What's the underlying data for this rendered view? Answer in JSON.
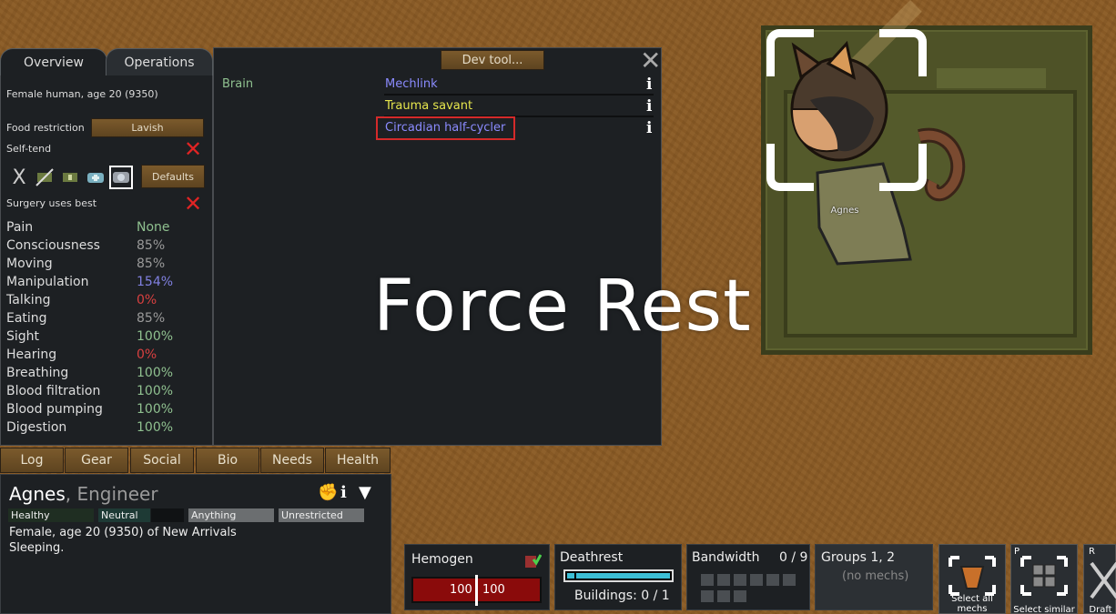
{
  "health_panel": {
    "tabs": [
      "Overview",
      "Operations"
    ],
    "summary": "Female human, age 20 (9350)",
    "food_restriction_label": "Food restriction",
    "food_restriction_value": "Lavish",
    "self_tend_label": "Self-tend",
    "defaults_label": "Defaults",
    "surgery_label": "Surgery uses best",
    "capacities": [
      {
        "name": "Pain",
        "value": "None",
        "color": "#8fc08f"
      },
      {
        "name": "Consciousness",
        "value": "85%",
        "color": "#9a9a9a"
      },
      {
        "name": "Moving",
        "value": "85%",
        "color": "#9a9a9a"
      },
      {
        "name": "Manipulation",
        "value": "154%",
        "color": "#8080e0"
      },
      {
        "name": "Talking",
        "value": "0%",
        "color": "#d84040"
      },
      {
        "name": "Eating",
        "value": "85%",
        "color": "#9a9a9a"
      },
      {
        "name": "Sight",
        "value": "100%",
        "color": "#8fc08f"
      },
      {
        "name": "Hearing",
        "value": "0%",
        "color": "#d84040"
      },
      {
        "name": "Breathing",
        "value": "100%",
        "color": "#8fc08f"
      },
      {
        "name": "Blood filtration",
        "value": "100%",
        "color": "#8fc08f"
      },
      {
        "name": "Blood pumping",
        "value": "100%",
        "color": "#8fc08f"
      },
      {
        "name": "Digestion",
        "value": "100%",
        "color": "#8fc08f"
      }
    ],
    "dev_tool_label": "Dev tool...",
    "body_part": "Brain",
    "hediffs": [
      {
        "name": "Mechlink",
        "color": "#8b8bff"
      },
      {
        "name": "Trauma savant",
        "color": "#e6e64d"
      },
      {
        "name": "Circadian half-cycler",
        "color": "#8b8bff"
      }
    ]
  },
  "overlay_text": "Force Rest",
  "pawn_label": "Agnes",
  "bottom_tabs": [
    "Log",
    "Gear",
    "Social",
    "Bio",
    "Needs",
    "Health"
  ],
  "inspect": {
    "name": "Agnes",
    "title": ", Engineer",
    "bars": [
      {
        "label": "Healthy"
      },
      {
        "label": "Neutral"
      },
      {
        "label": "Anything"
      },
      {
        "label": "Unrestricted"
      }
    ],
    "line1": "Female, age 20 (9350) of New Arrivals",
    "line2": "Sleeping."
  },
  "gizmos": {
    "hemogen_label": "Hemogen",
    "hemogen_value": "100",
    "hemogen_max": "100",
    "deathrest_label": "Deathrest",
    "deathrest_buildings": "Buildings: 0 / 1",
    "deathrest_fill": 1.0,
    "bandwidth_label": "Bandwidth",
    "bandwidth_value": "0 / 9",
    "groups_label": "Groups 1, 2",
    "groups_sub": "(no mechs)",
    "select_all_label": "Select all mechs",
    "select_similar_label": "Select similar",
    "select_similar_hotkey": "P",
    "draft_hotkey": "R",
    "draft_label": "Draft"
  }
}
